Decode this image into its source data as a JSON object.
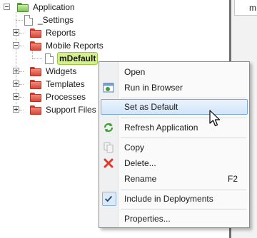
{
  "editor": {
    "tab_label": "mDefault"
  },
  "tree": {
    "root": {
      "label": "Application",
      "icon": "folder-open-icon",
      "color": "#7fc35a"
    },
    "children": [
      {
        "label": "_Settings",
        "icon": "page-icon"
      },
      {
        "label": "Reports",
        "icon": "folder-icon"
      },
      {
        "label": "Mobile Reports",
        "icon": "folder-icon",
        "expanded": true,
        "children": [
          {
            "label": "mDefault",
            "icon": "page-icon",
            "selected": true
          }
        ]
      },
      {
        "label": "Widgets",
        "icon": "folder-icon"
      },
      {
        "label": "Templates",
        "icon": "folder-icon"
      },
      {
        "label": "Processes",
        "icon": "folder-icon"
      },
      {
        "label": "Support Files",
        "icon": "folder-icon"
      }
    ],
    "folder_color": "#d6483a",
    "selected_highlight": "#d6ef8e"
  },
  "context_menu": {
    "items": [
      {
        "label": "Open",
        "icon": ""
      },
      {
        "label": "Run in Browser",
        "icon": "browser-window-icon"
      },
      {
        "label": "Set as Default",
        "icon": "",
        "highlighted": true
      },
      {
        "label": "Refresh Application",
        "icon": "refresh-icon"
      },
      {
        "label": "Copy",
        "icon": "copy-icon",
        "disabled": true
      },
      {
        "label": "Delete...",
        "icon": "delete-x-icon"
      },
      {
        "label": "Rename",
        "icon": "",
        "shortcut": "F2"
      },
      {
        "label": "Include in Deployments",
        "icon": "checkmark-icon",
        "checked": true
      },
      {
        "label": "Properties...",
        "icon": ""
      }
    ],
    "highlight_color": "#d2e5f8",
    "delete_color": "#e03a2f"
  }
}
